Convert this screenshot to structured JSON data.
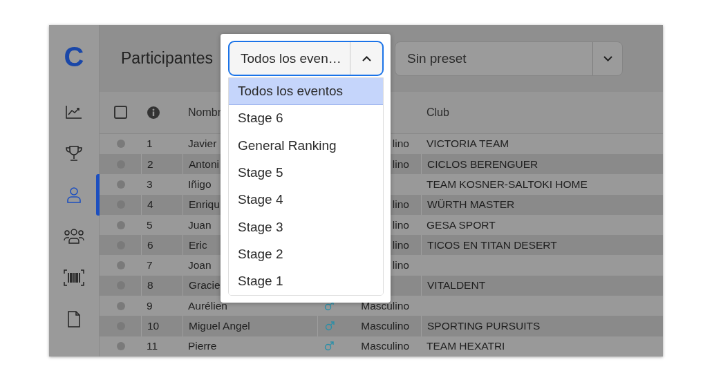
{
  "sidebar": {
    "logo": "C",
    "items": [
      {
        "kind": "chart",
        "selected": false
      },
      {
        "kind": "trophy",
        "selected": false
      },
      {
        "kind": "user",
        "selected": true
      },
      {
        "kind": "group",
        "selected": false
      },
      {
        "kind": "barcode",
        "selected": false
      },
      {
        "kind": "document",
        "selected": false
      }
    ]
  },
  "header": {
    "title": "Participantes",
    "event_select": {
      "value": "Todos los even…",
      "expanded": true
    },
    "preset_select": {
      "value": "Sin preset"
    }
  },
  "event_menu": [
    {
      "label": "Todos los eventos",
      "selected": true
    },
    {
      "label": "Stage 6",
      "selected": false
    },
    {
      "label": "General Ranking",
      "selected": false
    },
    {
      "label": "Stage 5",
      "selected": false
    },
    {
      "label": "Stage 4",
      "selected": false
    },
    {
      "label": "Stage 3",
      "selected": false
    },
    {
      "label": "Stage 2",
      "selected": false
    },
    {
      "label": "Stage 1",
      "selected": false
    }
  ],
  "table": {
    "select_all": {
      "checked": false
    },
    "columns": [
      "Nombr",
      "Club"
    ],
    "rows": [
      {
        "number": "1",
        "name": "Javier",
        "male_icon": false,
        "gender": "lino",
        "club": "VICTORIA TEAM"
      },
      {
        "number": "2",
        "name": "Antoni",
        "male_icon": false,
        "gender": "lino",
        "club": "CICLOS BERENGUER"
      },
      {
        "number": "3",
        "name": "Iñigo",
        "male_icon": false,
        "club": "TEAM KOSNER-SALTOKI HOME"
      },
      {
        "number": "4",
        "name": "Enriqu",
        "male_icon": false,
        "gender": "lino",
        "club": "WÜRTH MASTER"
      },
      {
        "number": "5",
        "name": "Juan",
        "male_icon": false,
        "gender": "lino",
        "club": "GESA SPORT"
      },
      {
        "number": "6",
        "name": "Eric",
        "male_icon": false,
        "gender": "lino",
        "club": "TICOS EN TITAN DESERT"
      },
      {
        "number": "7",
        "name": "Joan",
        "male_icon": false,
        "gender": "lino"
      },
      {
        "number": "8",
        "name": "Gracie",
        "male_icon": false,
        "club": "VITALDENT"
      },
      {
        "number": "9",
        "name": "Aurélien",
        "male_icon": true,
        "gender": "Masculino"
      },
      {
        "number": "10",
        "name": "Miguel Angel",
        "male_icon": true,
        "gender": "Masculino",
        "club": "SPORTING PURSUITS"
      },
      {
        "number": "11",
        "name": "Pierre",
        "male_icon": true,
        "gender": "Masculino",
        "club": "TEAM HEXATRI"
      }
    ]
  }
}
